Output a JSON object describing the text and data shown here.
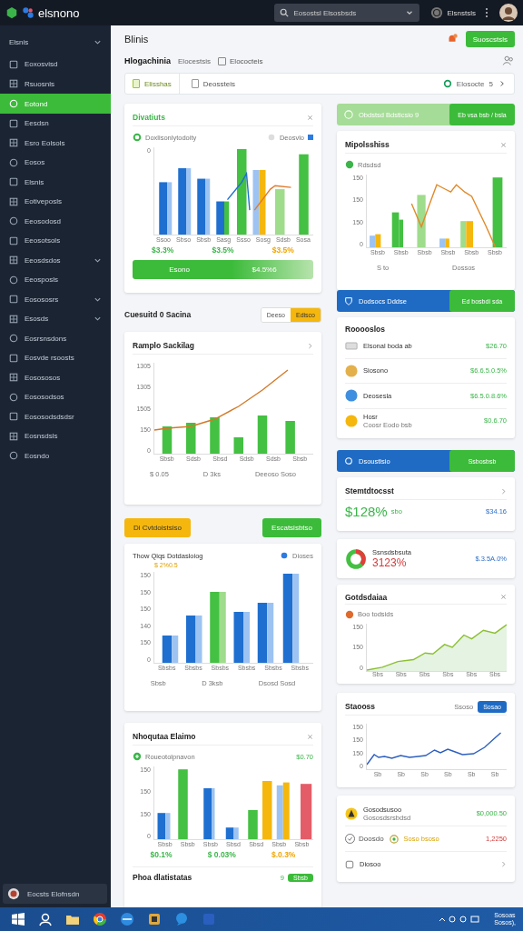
{
  "topbar": {
    "brand": "elsnono",
    "search": {
      "value": "Eosostsl Elsosbsds"
    },
    "user": "Elsnstsls"
  },
  "sidebar": {
    "items": [
      {
        "label": "Elsnis",
        "kind": "section",
        "expandable": true,
        "selected": false
      },
      {
        "label": "Eoxosvisd",
        "kind": "item",
        "expandable": false,
        "selected": false
      },
      {
        "label": "Rsuosnls",
        "kind": "item",
        "expandable": false,
        "selected": false
      },
      {
        "label": "Eotond",
        "kind": "item",
        "expandable": false,
        "selected": true
      },
      {
        "label": "Eesdsn",
        "kind": "item",
        "expandable": false,
        "selected": false
      },
      {
        "label": "Esro Eolsols",
        "kind": "item",
        "expandable": false,
        "selected": false
      },
      {
        "label": "Eosos",
        "kind": "item",
        "expandable": false,
        "selected": false
      },
      {
        "label": "Elsnis",
        "kind": "item",
        "expandable": false,
        "selected": false
      },
      {
        "label": "Eotiveposls",
        "kind": "item",
        "expandable": false,
        "selected": false
      },
      {
        "label": "Eeosodosd",
        "kind": "item",
        "expandable": false,
        "selected": false
      },
      {
        "label": "Eeosotsols",
        "kind": "item",
        "expandable": false,
        "selected": false
      },
      {
        "label": "Eeosdsdos",
        "kind": "item",
        "expandable": true,
        "selected": false
      },
      {
        "label": "Eeosposls",
        "kind": "item",
        "expandable": false,
        "selected": false
      },
      {
        "label": "Eosososrs",
        "kind": "item",
        "expandable": true,
        "selected": false
      },
      {
        "label": "Esosds",
        "kind": "item",
        "expandable": true,
        "selected": false
      },
      {
        "label": "Eosrsnsdons",
        "kind": "item",
        "expandable": false,
        "selected": false
      },
      {
        "label": "Eosvde rsoosts",
        "kind": "item",
        "expandable": false,
        "selected": false
      },
      {
        "label": "Eosososos",
        "kind": "item",
        "expandable": false,
        "selected": false
      },
      {
        "label": "Eososodsos",
        "kind": "item",
        "expandable": false,
        "selected": false
      },
      {
        "label": "Eososodsdsdsr",
        "kind": "item",
        "expandable": false,
        "selected": false
      },
      {
        "label": "Eosnsdsls",
        "kind": "item",
        "expandable": false,
        "selected": false
      },
      {
        "label": "Eosndo",
        "kind": "item",
        "expandable": false,
        "selected": false
      }
    ],
    "footer": "Eocsts Elofnsdn"
  },
  "header": {
    "title": "Blinis",
    "action": "Suoscstsls",
    "subtitle": "Hlogachinia",
    "note": "Elocestsis",
    "filter": {
      "label": "Elococteis",
      "checked": false
    },
    "tabs": [
      {
        "label": "Elisshas",
        "selected": true
      },
      {
        "label": "Deossteis",
        "selected": false
      }
    ],
    "status": {
      "label": "Elosocte",
      "count": "5"
    }
  },
  "left": {
    "trend": {
      "title": "Divatiuts",
      "legend": [
        "Doxlisonlytodoity",
        "Deosvlo"
      ],
      "chart": {
        "kind": "grouped",
        "ticks": [
          "0"
        ],
        "xlabels": [
          "Ssoo",
          "Sbso",
          "Sbsb",
          "Sasg",
          "Ssso",
          "Sosg",
          "Sdsb",
          "Sosa"
        ]
      },
      "values": [
        {
          "text": "$3.3%",
          "color": "#3bb54a"
        },
        {
          "text": "$3.5%",
          "color": "#3bb54a"
        },
        {
          "text": "$3.5%",
          "color": "#f0a500"
        }
      ],
      "bar": {
        "label": "Esono",
        "value": "$4.5%6"
      }
    },
    "toolbar": {
      "title": "Cuesuitd 0 Sacina",
      "options": [
        {
          "label": "Deeso",
          "selected": false
        },
        {
          "label": "Edisco",
          "selected": true
        }
      ]
    },
    "sales": {
      "title": "Ramplo Sackilag",
      "chart": {
        "kind": "combo",
        "ticks": [
          "1305",
          "1305",
          "1505",
          "150",
          "0"
        ],
        "xlabels": [
          "Sbsb",
          "Sdsb",
          "Sbsd",
          "Sdsb",
          "Sdsb",
          "Sbsb"
        ]
      },
      "legend": [
        "$ 0.05",
        "D 3ks",
        "Deeoso Soso"
      ]
    },
    "buttons": [
      {
        "label": "Di Cvtdoistsiso",
        "kind": "warning"
      },
      {
        "label": "Escatsisbtso",
        "kind": "primary"
      }
    ],
    "compare": {
      "title": "Thow Qiqs Dotdasloiog",
      "tag": "Dioses",
      "highlight": "$ 2%0.5",
      "chart": {
        "kind": "grouped2",
        "ticks": [
          "150",
          "150",
          "150",
          "140",
          "150",
          "0"
        ],
        "xlabels": [
          "Sbsbs",
          "Sbsbs",
          "Sbsbs",
          "Sbsbs",
          "Sbsbs",
          "Sbsbs"
        ]
      },
      "legend": [
        "Sbsb",
        "D 3ksb",
        "Dsosd Sosd"
      ]
    },
    "mix": {
      "title": "Nhoqutaa Elaimo",
      "row": {
        "label": "Roueotolpnavon",
        "value": "$0.70"
      },
      "chart": {
        "kind": "multi",
        "ticks": [
          "150",
          "150",
          "150",
          "0"
        ],
        "xlabels": [
          "Sbsb",
          "Sbsb",
          "Sbsb",
          "Sbsd",
          "Sbsd",
          "Sbsb",
          "Sbsb"
        ]
      },
      "values": [
        {
          "text": "$0.1%",
          "color": "#3bb54a"
        },
        {
          "text": "$ 0.03%",
          "color": "#3bb54a"
        },
        {
          "text": "$.0.3%",
          "color": "#f0a500"
        }
      ],
      "footer": {
        "label": "Phoa dlatistatas",
        "count": "9",
        "pill": "Sbsb"
      }
    }
  },
  "right": {
    "banner1": {
      "label": "Obdstsd Bdsticsio 9",
      "action": "Eb vsa bsb / bsla"
    },
    "mixed": {
      "title": "Mipolsshiss",
      "legend": "Rdsdsd",
      "chart": {
        "kind": "mixed",
        "ticks": [
          "150",
          "150",
          "150",
          "0"
        ],
        "xlabels": [
          "Sbsb",
          "Sbsb",
          "Sbsb",
          "Sbsb",
          "Sbsb",
          "Sbsb"
        ]
      },
      "keys": [
        "S to",
        "Dossos"
      ]
    },
    "banner2": {
      "label": "Dodsocs Dddse",
      "action": "Ed bosbdi sda"
    },
    "list": {
      "title": "Rooooslos",
      "items": [
        {
          "name": "Elsonal boda ab",
          "value": "$26.70"
        },
        {
          "name": "Siosono",
          "value": "$6.6.5.0.5%"
        },
        {
          "name": "Deosesla",
          "value": "$6.5.0.8.6%"
        },
        {
          "name": "Hosr",
          "sub": "Coosr Eodo bsb",
          "value": "$0.6.70"
        }
      ]
    },
    "banner3": {
      "label": "Dsoustlsio",
      "action": "Ssbosbsb"
    },
    "stat": {
      "title": "Stemtdtocsst",
      "value": "$128%",
      "unit": "sbo",
      "side": "$34.16"
    },
    "donut": {
      "title": "Ssnsdsbsuta",
      "value": "3123%",
      "side": "$.3.5A.0%"
    },
    "growth": {
      "title": "Gotdsdaiaa",
      "legend": "Boo todsids",
      "chart": {
        "kind": "area",
        "ticks": [
          "150",
          "150",
          "0"
        ],
        "xlabels": [
          "Sbs",
          "Sbs",
          "Sbs",
          "Sbs",
          "Sbs",
          "Sbs"
        ]
      }
    },
    "stocks": {
      "title": "Staooss",
      "filter": "Ssoso",
      "action": "Sosao",
      "chart": {
        "kind": "line",
        "ticks": [
          "150",
          "150",
          "150",
          "0"
        ],
        "xlabels": [
          "Sb",
          "Sb",
          "Sb",
          "Sb",
          "Sb",
          "Sb"
        ]
      }
    },
    "summary": {
      "title": "Gosodsusoo",
      "sub": "Gososdsrsbdsd",
      "value": "$0,000.50",
      "check": {
        "label": "Doosdo",
        "checked": true
      },
      "tag": "Soso bsoso",
      "amount": "1,2250",
      "last": "Diosoo"
    }
  },
  "taskbar": {
    "clock": [
      "Sosoas",
      "Sosos),"
    ]
  }
}
